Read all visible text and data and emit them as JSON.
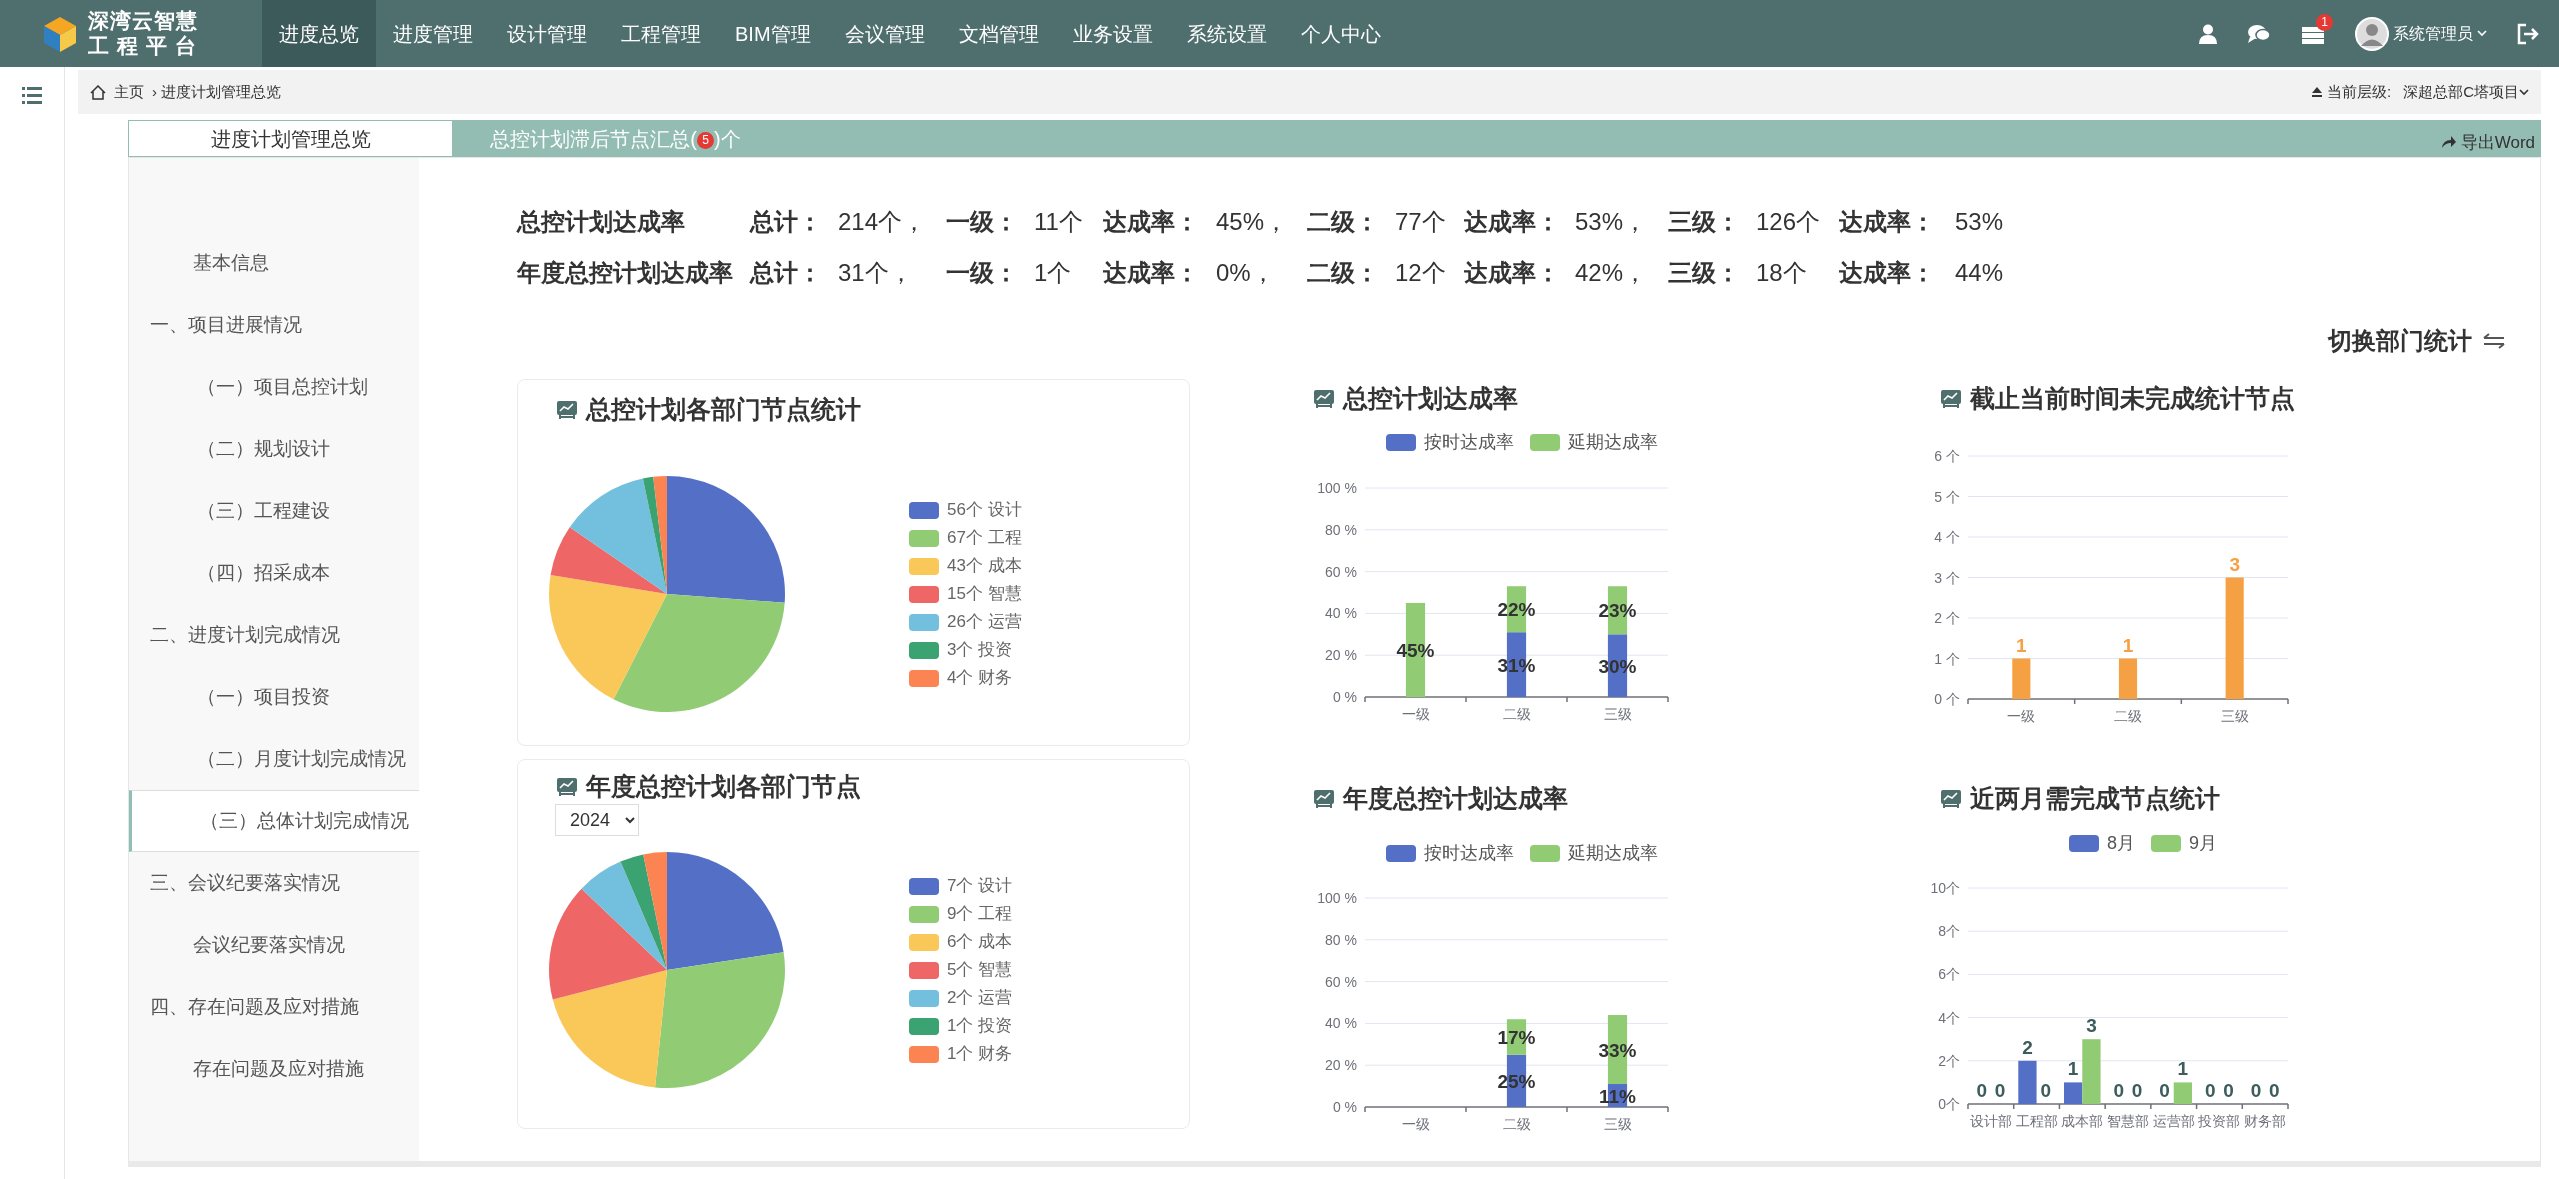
{
  "brand": {
    "line_1": "深湾云智慧",
    "line_2": "工 程 平 台"
  },
  "nav": [
    {
      "label": "进度总览",
      "selected": true
    },
    {
      "label": "进度管理",
      "selected": false
    },
    {
      "label": "设计管理",
      "selected": false
    },
    {
      "label": "工程管理",
      "selected": false
    },
    {
      "label": "BIM管理",
      "selected": false
    },
    {
      "label": "会议管理",
      "selected": false
    },
    {
      "label": "文档管理",
      "selected": false
    },
    {
      "label": "业务设置",
      "selected": false
    },
    {
      "label": "系统设置",
      "selected": false
    },
    {
      "label": "个人中心",
      "selected": false
    }
  ],
  "user": {
    "notification_count": "1",
    "name": "系统管理员"
  },
  "breadcrumb": {
    "home": "主页",
    "separator": "›",
    "current": "进度计划管理总览"
  },
  "level": {
    "label": "当前层级:",
    "value": "深超总部C塔项目"
  },
  "tabs": [
    {
      "label": "进度计划管理总览",
      "selected": true
    },
    {
      "label": "总控计划滞后节点汇总(",
      "badge": "5",
      "suffix": ")个",
      "selected": false
    }
  ],
  "export_button": "导出Word",
  "outline": [
    {
      "label": "基本信息",
      "kind": "plain",
      "selected": false
    },
    {
      "label": "一、项目进展情况",
      "kind": "heading",
      "selected": false,
      "children": [
        {
          "label": "（一）项目总控计划",
          "kind": "numbered",
          "selected": false
        },
        {
          "label": "（二）规划设计",
          "kind": "numbered",
          "selected": false
        },
        {
          "label": "（三）工程建设",
          "kind": "numbered",
          "selected": false
        },
        {
          "label": "（四）招采成本",
          "kind": "numbered",
          "selected": false
        }
      ]
    },
    {
      "label": "二、进度计划完成情况",
      "kind": "heading",
      "selected": false,
      "children": [
        {
          "label": "（一）项目投资",
          "kind": "numbered",
          "selected": false
        },
        {
          "label": "（二）月度计划完成情况",
          "kind": "numbered",
          "selected": false
        },
        {
          "label": "（三）总体计划完成情况",
          "kind": "numbered",
          "selected": true
        }
      ]
    },
    {
      "label": "三、会议纪要落实情况",
      "kind": "heading",
      "selected": false,
      "children": [
        {
          "label": "会议纪要落实情况",
          "kind": "plain",
          "selected": false
        }
      ]
    },
    {
      "label": "四、存在问题及应对措施",
      "kind": "heading",
      "selected": false,
      "children": [
        {
          "label": "存在问题及应对措施",
          "kind": "plain",
          "selected": false
        }
      ]
    }
  ],
  "summary": [
    {
      "title": "总控计划达成率",
      "cells": [
        {
          "label": "总计：",
          "value": "214个，"
        },
        {
          "label": "一级：",
          "value": "11个"
        },
        {
          "label": "达成率：",
          "value": "45%，"
        },
        {
          "label": "二级：",
          "value": "77个"
        },
        {
          "label": "达成率：",
          "value": "53%，"
        },
        {
          "label": "三级：",
          "value": "126个"
        },
        {
          "label": "达成率：",
          "value": "53%"
        }
      ]
    },
    {
      "title": "年度总控计划达成率",
      "cells": [
        {
          "label": "总计：",
          "value": "31个，"
        },
        {
          "label": "一级：",
          "value": "1个"
        },
        {
          "label": "达成率：",
          "value": "0%，"
        },
        {
          "label": "二级：",
          "value": "12个"
        },
        {
          "label": "达成率：",
          "value": "42%，"
        },
        {
          "label": "三级：",
          "value": "18个"
        },
        {
          "label": "达成率：",
          "value": "44%"
        }
      ]
    }
  ],
  "switch_link": "切换部门统计",
  "columns": [
    [
      {
        "title": "总控计划各部门节点统计",
        "slice_colors": [
          {
            "color": "#5470c6"
          },
          {
            "color": "#91cc75"
          },
          {
            "color": "#fac858"
          },
          {
            "color": "#ee6666"
          },
          {
            "color": "#73c0de"
          },
          {
            "color": "#3ba272"
          },
          {
            "color": "#fc8452"
          }
        ],
        "chart_data": {
          "type": "pie",
          "legend": "right",
          "categories": [
            "56个 设计",
            "67个 工程",
            "43个 成本",
            "15个 智慧",
            "26个 运营",
            "3个 投资",
            "4个 财务"
          ],
          "values": [
            56,
            67,
            43,
            15,
            26,
            3,
            4
          ]
        }
      },
      {
        "title": "年度总控计划各部门节点",
        "year": "2024",
        "slice_colors": [
          {
            "color": "#5470c6"
          },
          {
            "color": "#91cc75"
          },
          {
            "color": "#fac858"
          },
          {
            "color": "#ee6666"
          },
          {
            "color": "#73c0de"
          },
          {
            "color": "#3ba272"
          },
          {
            "color": "#fc8452"
          }
        ],
        "chart_data": {
          "type": "pie",
          "legend": "right",
          "categories": [
            "7个 设计",
            "9个 工程",
            "6个 成本",
            "5个 智慧",
            "2个 运营",
            "1个 投资",
            "1个 财务"
          ],
          "values": [
            7,
            9,
            6,
            5,
            2,
            1,
            1
          ]
        }
      }
    ],
    [
      {
        "title": "总控计划达成率",
        "chart_data": {
          "type": "bar",
          "stacked": true,
          "grid": true,
          "legend": "top",
          "categories": [
            "一级",
            "二级",
            "三级"
          ],
          "ylim": [
            0,
            100
          ],
          "yticks": [
            {
              "value": 0,
              "label": "0 %"
            },
            {
              "value": 20,
              "label": "20 %"
            },
            {
              "value": 40,
              "label": "40 %"
            },
            {
              "value": 60,
              "label": "60 %"
            },
            {
              "value": 80,
              "label": "80 %"
            },
            {
              "value": 100,
              "label": "100 %"
            }
          ],
          "series": [
            {
              "name": "按时达成率",
              "color": "#5470c6",
              "values": [
                null,
                31,
                30
              ],
              "value_labels": [
                null,
                "31%",
                "30%"
              ]
            },
            {
              "name": "延期达成率",
              "color": "#91cc75",
              "values": [
                45,
                22,
                23
              ],
              "value_labels": [
                "45%",
                "22%",
                "23%"
              ]
            }
          ]
        }
      },
      {
        "title": "年度总控计划达成率",
        "chart_data": {
          "type": "bar",
          "stacked": true,
          "grid": true,
          "legend": "top",
          "categories": [
            "一级",
            "二级",
            "三级"
          ],
          "ylim": [
            0,
            100
          ],
          "yticks": [
            {
              "value": 0,
              "label": "0 %"
            },
            {
              "value": 20,
              "label": "20 %"
            },
            {
              "value": 40,
              "label": "40 %"
            },
            {
              "value": 60,
              "label": "60 %"
            },
            {
              "value": 80,
              "label": "80 %"
            },
            {
              "value": 100,
              "label": "100 %"
            }
          ],
          "series": [
            {
              "name": "按时达成率",
              "color": "#5470c6",
              "values": [
                null,
                25,
                11
              ],
              "value_labels": [
                null,
                "25%",
                "11%"
              ]
            },
            {
              "name": "延期达成率",
              "color": "#91cc75",
              "values": [
                null,
                17,
                33
              ],
              "value_labels": [
                null,
                "17%",
                "33%"
              ]
            }
          ]
        }
      }
    ],
    [
      {
        "title": "截止当前时间未完成统计节点",
        "chart_data": {
          "type": "bar",
          "grid": true,
          "categories": [
            "一级",
            "二级",
            "三级"
          ],
          "ylim": [
            0,
            6
          ],
          "yticks": [
            {
              "value": 0,
              "label": "0 个"
            },
            {
              "value": 1,
              "label": "1 个"
            },
            {
              "value": 2,
              "label": "2 个"
            },
            {
              "value": 3,
              "label": "3 个"
            },
            {
              "value": 4,
              "label": "4 个"
            },
            {
              "value": 5,
              "label": "5 个"
            },
            {
              "value": 6,
              "label": "6 个"
            }
          ],
          "series": [
            {
              "color": "#f5a043",
              "values": [
                1,
                1,
                3
              ],
              "value_labels": [
                "1",
                "1",
                "3"
              ]
            }
          ]
        }
      },
      {
        "title": "近两月需完成节点统计",
        "chart_data": {
          "type": "bar",
          "grid": true,
          "legend": "top",
          "categories": [
            "设计部",
            "工程部",
            "成本部",
            "智慧部",
            "运营部",
            "投资部",
            "财务部"
          ],
          "ylim": [
            0,
            10
          ],
          "yticks": [
            {
              "value": 0,
              "label": "0个"
            },
            {
              "value": 2,
              "label": "2个"
            },
            {
              "value": 4,
              "label": "4个"
            },
            {
              "value": 6,
              "label": "6个"
            },
            {
              "value": 8,
              "label": "8个"
            },
            {
              "value": 10,
              "label": "10个"
            }
          ],
          "series": [
            {
              "name": "8月",
              "color": "#5470c6",
              "values": [
                0,
                2,
                1,
                0,
                0,
                0,
                0
              ],
              "value_labels": [
                "0",
                "2",
                "1",
                "0",
                "0",
                "0",
                "0"
              ]
            },
            {
              "name": "9月",
              "color": "#91cc75",
              "values": [
                0,
                0,
                3,
                0,
                1,
                0,
                0
              ],
              "value_labels": [
                "0",
                "0",
                "3",
                "0",
                "1",
                "0",
                "0"
              ]
            }
          ]
        }
      }
    ]
  ]
}
